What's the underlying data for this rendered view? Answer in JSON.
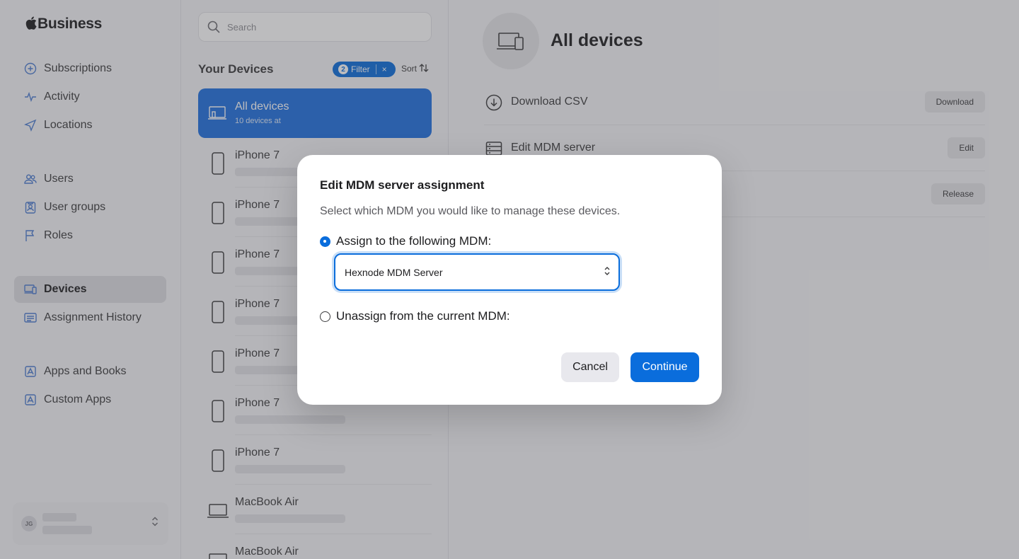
{
  "brand": {
    "name": "Business"
  },
  "sidebar": {
    "items": [
      {
        "label": "Subscriptions",
        "icon": "plus-circle-icon"
      },
      {
        "label": "Activity",
        "icon": "activity-icon"
      },
      {
        "label": "Locations",
        "icon": "location-arrow-icon"
      },
      {
        "label": "Users",
        "icon": "users-icon"
      },
      {
        "label": "User groups",
        "icon": "user-group-icon"
      },
      {
        "label": "Roles",
        "icon": "flag-icon"
      },
      {
        "label": "Devices",
        "icon": "devices-icon",
        "active": true
      },
      {
        "label": "Assignment History",
        "icon": "list-icon"
      },
      {
        "label": "Apps and Books",
        "icon": "app-icon"
      },
      {
        "label": "Custom Apps",
        "icon": "app-icon"
      }
    ],
    "account": {
      "initials": "JG"
    }
  },
  "device_list": {
    "search_placeholder": "Search",
    "title": "Your Devices",
    "filter": {
      "count": "2",
      "label": "Filter",
      "clear": "×"
    },
    "sort_label": "Sort",
    "all_devices": {
      "title": "All devices",
      "subtitle": "10 devices at"
    },
    "devices": [
      {
        "name": "iPhone 7",
        "type": "phone"
      },
      {
        "name": "iPhone 7",
        "type": "phone"
      },
      {
        "name": "iPhone 7",
        "type": "phone"
      },
      {
        "name": "iPhone 7",
        "type": "phone"
      },
      {
        "name": "iPhone 7",
        "type": "phone"
      },
      {
        "name": "iPhone 7",
        "type": "phone"
      },
      {
        "name": "iPhone 7",
        "type": "phone"
      },
      {
        "name": "MacBook Air",
        "type": "laptop"
      },
      {
        "name": "MacBook Air",
        "type": "laptop"
      }
    ]
  },
  "detail": {
    "title": "All devices",
    "actions": [
      {
        "label": "Download CSV",
        "button": "Download"
      },
      {
        "label": "Edit MDM server",
        "button": "Edit"
      },
      {
        "label": "",
        "button": "Release"
      }
    ]
  },
  "modal": {
    "title": "Edit MDM server assignment",
    "description": "Select which MDM you would like to manage these devices.",
    "option_assign": "Assign to the following MDM:",
    "selected_mdm": "Hexnode MDM Server",
    "option_unassign": "Unassign from the current MDM:",
    "cancel": "Cancel",
    "continue": "Continue"
  },
  "colors": {
    "accent": "#0a6ddc",
    "background": "#f5f5f7"
  }
}
